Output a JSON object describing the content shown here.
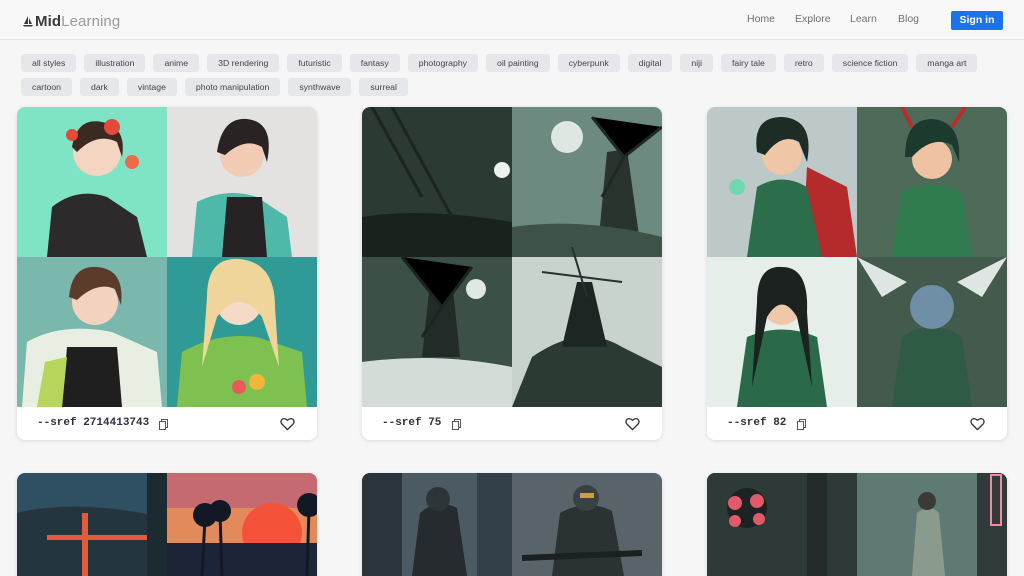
{
  "logo": {
    "mark": "sailboat-icon",
    "mid": "Mid",
    "rest": "Learning"
  },
  "nav": [
    {
      "label": "Home"
    },
    {
      "label": "Explore"
    },
    {
      "label": "Learn"
    },
    {
      "label": "Blog"
    }
  ],
  "signin": {
    "label": "Sign in",
    "color": "#1a73e8"
  },
  "tags_row1": [
    "all styles",
    "illustration",
    "anime",
    "3D rendering",
    "futuristic",
    "fantasy",
    "photography",
    "oil painting",
    "cyberpunk",
    "digital",
    "niji",
    "fairy tale",
    "retro",
    "science fiction",
    "manga art"
  ],
  "tags_row2": [
    "cartoon",
    "dark",
    "vintage",
    "photo manipulation",
    "synthwave",
    "surreal"
  ],
  "cards": [
    {
      "sref": "--sref 2714413743",
      "theme": "anime girls with flowers",
      "copy_icon": "copy-icon",
      "like_icon": "heart-icon"
    },
    {
      "sref": "--sref 75",
      "theme": "dark green windmill landscapes",
      "copy_icon": "copy-icon",
      "like_icon": "heart-icon"
    },
    {
      "sref": "--sref 82",
      "theme": "anime warrior women in forest",
      "copy_icon": "copy-icon",
      "like_icon": "heart-icon"
    },
    {
      "sref": "",
      "theme": "synthwave sunset with palm trees"
    },
    {
      "sref": "",
      "theme": "armored soldiers in dark city"
    },
    {
      "sref": "",
      "theme": "cyberpunk woman in alley with neon"
    }
  ]
}
